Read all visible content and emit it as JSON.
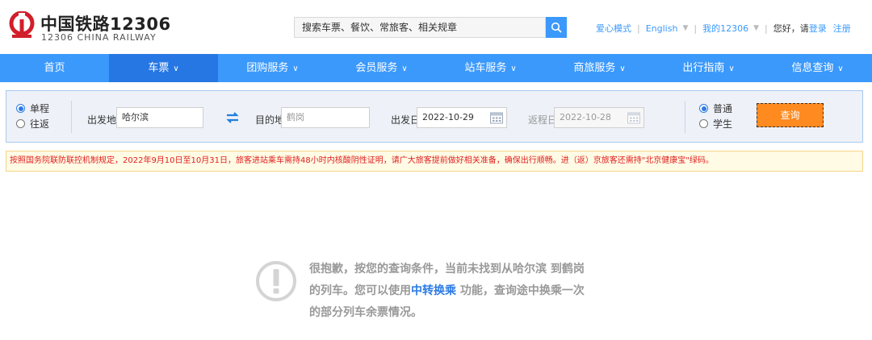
{
  "header": {
    "logo_cn": "中国铁路12306",
    "logo_en": "12306 CHINA RAILWAY",
    "search_placeholder": "搜索车票、餐饮、常旅客、相关规章",
    "links": {
      "care_mode": "爱心模式",
      "language": "English",
      "my12306": "我的12306",
      "greeting": "您好，请",
      "login": "登录",
      "register": "注册"
    }
  },
  "nav": {
    "items": [
      {
        "label": "首页",
        "dropdown": false
      },
      {
        "label": "车票",
        "dropdown": true
      },
      {
        "label": "团购服务",
        "dropdown": true
      },
      {
        "label": "会员服务",
        "dropdown": true
      },
      {
        "label": "站车服务",
        "dropdown": true
      },
      {
        "label": "商旅服务",
        "dropdown": true
      },
      {
        "label": "出行指南",
        "dropdown": true
      },
      {
        "label": "信息查询",
        "dropdown": true
      }
    ],
    "active_index": 1
  },
  "query": {
    "trip_types": [
      "单程",
      "往返"
    ],
    "trip_selected": "单程",
    "from_label": "出发地",
    "from_value": "哈尔滨",
    "to_label": "目的地",
    "to_value": "鹤岗",
    "depart_label": "出发日",
    "depart_value": "2022-10-29",
    "return_label": "返程日",
    "return_value": "2022-10-28",
    "passenger_types": [
      "普通",
      "学生"
    ],
    "passenger_selected": "普通",
    "submit_label": "查询"
  },
  "notice": "按照国务院联防联控机制规定，2022年9月10日至10月31日，旅客进站乘车需持48小时内核酸阴性证明，请广大旅客提前做好相关准备，确保出行顺畅。进（返）京旅客还需持\"北京健康宝\"绿码。",
  "empty_result": {
    "line1": "很抱歉，按您的查询条件，当前未找到从哈尔滨 到鹤岗",
    "line2_prefix": "的列车。您可以使用",
    "line2_link": "中转换乘",
    "line2_suffix": " 功能，查询途中换乘一次",
    "line3": "的部分列车余票情况。"
  },
  "colors": {
    "brand_blue": "#3b99fc",
    "nav_active": "#2676e3",
    "query_button": "#ff8a1f",
    "notice_text": "#e02020",
    "logo_red": "#d11f2b"
  }
}
